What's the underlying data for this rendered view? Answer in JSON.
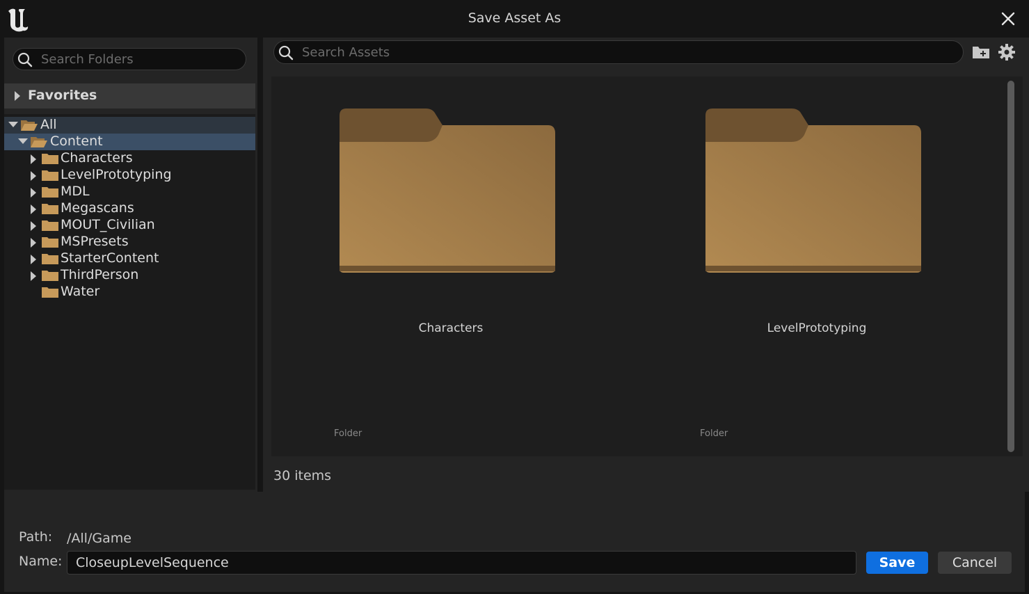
{
  "window": {
    "title": "Save Asset As"
  },
  "icons": {
    "logo": "unreal-logo-icon",
    "close": "close-icon",
    "search": "search-icon",
    "add_folder": "folder-add-icon",
    "settings": "gear-icon",
    "folder": "folder-icon"
  },
  "colors": {
    "accent": "#0f6fe0",
    "folder": "#b28a4f",
    "selection": "#3b4f66"
  },
  "folders_panel": {
    "search_placeholder": "Search Folders",
    "favorites_label": "Favorites",
    "tree": {
      "root": "All",
      "content": "Content",
      "children": [
        "Characters",
        "LevelPrototyping",
        "MDL",
        "Megascans",
        "MOUT_Civilian",
        "MSPresets",
        "StarterContent",
        "ThirdPerson",
        "Water"
      ]
    }
  },
  "assets_panel": {
    "search_placeholder": "Search Assets",
    "tiles": [
      {
        "name": "Characters",
        "type": "Folder"
      },
      {
        "name": "LevelPrototyping",
        "type": "Folder"
      }
    ],
    "item_count": "30 items"
  },
  "footer": {
    "path_label": "Path:",
    "path_value": "/All/Game",
    "name_label": "Name:",
    "name_value": "CloseupLevelSequence",
    "save_label": "Save",
    "cancel_label": "Cancel"
  }
}
